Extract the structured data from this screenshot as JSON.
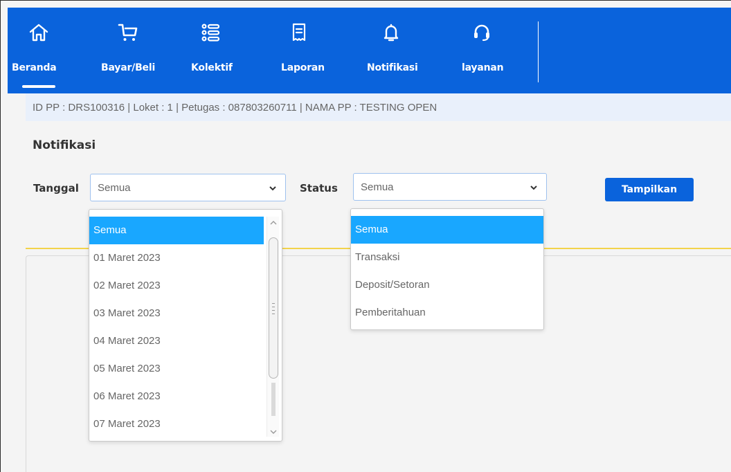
{
  "nav": {
    "items": [
      {
        "label": "Beranda",
        "icon": "home-icon"
      },
      {
        "label": "Bayar/Beli",
        "icon": "cart-icon"
      },
      {
        "label": "Kolektif",
        "icon": "list-icon"
      },
      {
        "label": "Laporan",
        "icon": "receipt-icon"
      },
      {
        "label": "Notifikasi",
        "icon": "bell-icon"
      },
      {
        "label": "layanan",
        "icon": "headset-icon"
      }
    ],
    "active": "Beranda",
    "color": "#0a63dc"
  },
  "info": {
    "text": "ID PP : DRS100316 | Loket : 1 | Petugas : 087803260711 | NAMA PP : TESTING OPEN"
  },
  "page": {
    "title": "Notifikasi"
  },
  "filters": {
    "tanggal": {
      "label": "Tanggal",
      "value": "Semua",
      "options": [
        "Semua",
        "01 Maret 2023",
        "02 Maret 2023",
        "03 Maret 2023",
        "04 Maret 2023",
        "05 Maret 2023",
        "06 Maret 2023",
        "07 Maret 2023"
      ]
    },
    "status": {
      "label": "Status",
      "value": "Semua",
      "options": [
        "Semua",
        "Transaksi",
        "Deposit/Setoran",
        "Pemberitahuan"
      ]
    },
    "submit_label": "Tampilkan"
  },
  "colors": {
    "primary": "#0a63dc",
    "selected_option": "#19a7ff",
    "accent_line": "#f2d34a"
  }
}
